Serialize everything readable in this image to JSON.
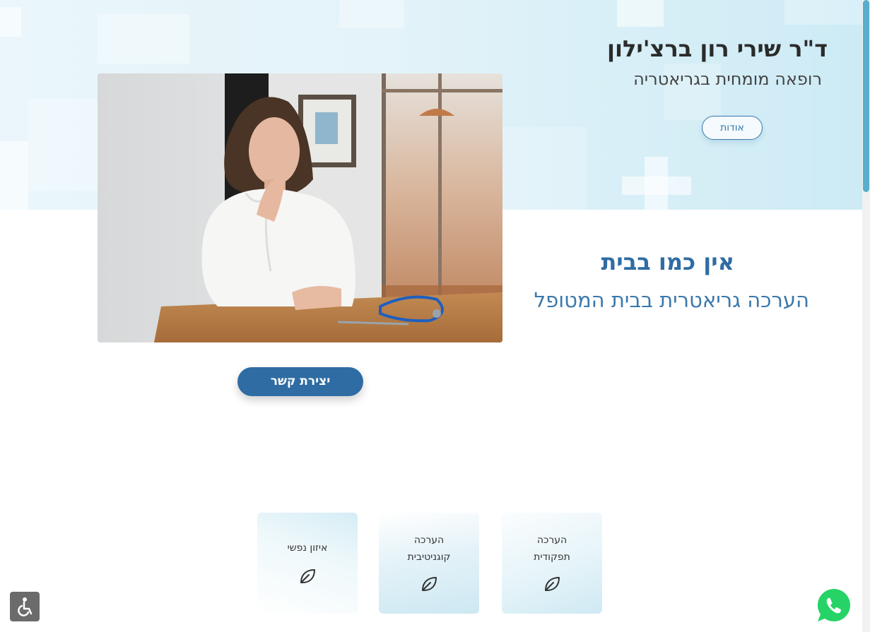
{
  "header": {
    "doctor_name": "ד\"ר שירי רון ברצ'ילון",
    "doctor_title": "רופאה מומחית בגריאטריה",
    "about_label": "אודות"
  },
  "hero": {
    "photo_icon": "doctor-portrait-photo",
    "tagline_title": "אין כמו בבית",
    "tagline_subtitle": "הערכה גריאטרית בבית המטופל",
    "contact_label": "יצירת קשר"
  },
  "services": [
    {
      "title_line1": "הערכה",
      "title_line2": "תפקודית",
      "icon": "leaf-icon"
    },
    {
      "title_line1": "הערכה",
      "title_line2": "קוגניטיבית",
      "icon": "leaf-icon"
    },
    {
      "title_line1": "איזון נפשי",
      "title_line2": "",
      "icon": "leaf-icon"
    }
  ],
  "widgets": {
    "accessibility_icon": "accessibility-icon",
    "whatsapp_icon": "whatsapp-icon"
  },
  "colors": {
    "primary": "#2f6ca3",
    "accent_light": "#cdebf5",
    "whatsapp": "#25d366"
  }
}
